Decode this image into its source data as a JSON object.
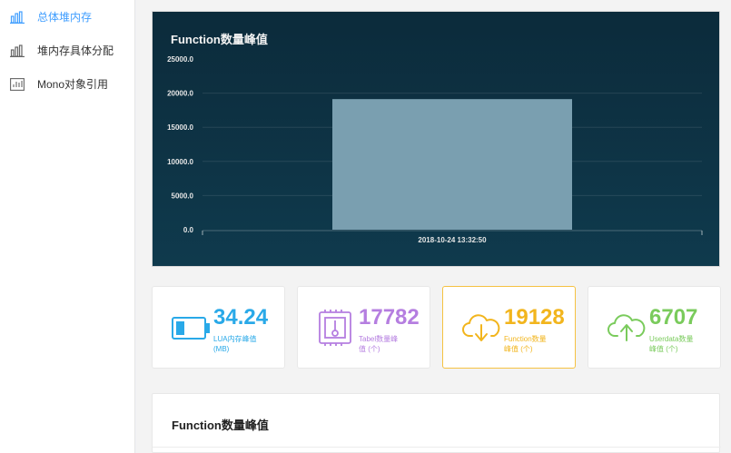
{
  "sidebar": {
    "items": [
      {
        "label": "总体堆内存",
        "icon": "bar-chart-icon",
        "active": true
      },
      {
        "label": "堆内存具体分配",
        "icon": "bar-chart-icon",
        "active": false
      },
      {
        "label": "Mono对象引用",
        "icon": "chart-box-icon",
        "active": false
      }
    ]
  },
  "chart": {
    "title": "Function数量峰值"
  },
  "chart_data": {
    "type": "bar",
    "title": "Function数量峰值",
    "categories": [
      "2018-10-24 13:32:50"
    ],
    "values": [
      19128
    ],
    "yticks": [
      "25000.0",
      "20000.0",
      "15000.0",
      "10000.0",
      "5000.0",
      "0.0"
    ],
    "ylim": [
      0,
      25000
    ],
    "grid": true,
    "bar_color": "#7a9fb0"
  },
  "stats": [
    {
      "value": "34.24",
      "label": "LUA内存峰值 (MB)",
      "color": "#29a9e8",
      "icon": "battery-icon"
    },
    {
      "value": "17782",
      "label": "Tabel数量峰值 (个)",
      "color": "#b57ee0",
      "icon": "thermometer-chip-icon"
    },
    {
      "value": "19128",
      "label": "Function数量峰值 (个)",
      "color": "#f2b51d",
      "icon": "cloud-download-icon"
    },
    {
      "value": "6707",
      "label": "Userdata数量峰值 (个)",
      "color": "#7acb5c",
      "icon": "cloud-upload-icon"
    }
  ],
  "bottom": {
    "title": "Function数量峰值"
  }
}
